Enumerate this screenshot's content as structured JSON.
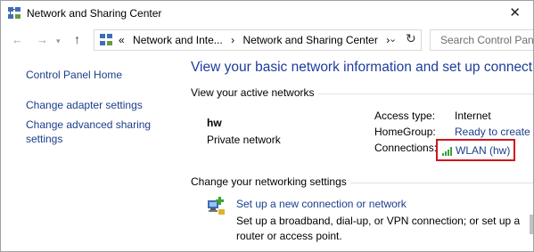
{
  "window": {
    "title": "Network and Sharing Center",
    "close_glyph": "✕"
  },
  "nav": {
    "back_glyph": "←",
    "forward_glyph": "→",
    "recent_glyph": "▾",
    "up_glyph": "↑",
    "address": {
      "overflow": "«",
      "crumb1": "Network and Inte...",
      "sep1": "›",
      "crumb2": "Network and Sharing Center",
      "sep2": "›",
      "dropdown_glyph": "⌄",
      "refresh_glyph": "↻"
    },
    "search_placeholder": "Search Control Panel"
  },
  "sidebar": {
    "home": "Control Panel Home",
    "adapter": "Change adapter settings",
    "advanced": "Change advanced sharing settings"
  },
  "main": {
    "title": "View your basic network information and set up connections",
    "active_header": "View your active networks",
    "network": {
      "name": "hw",
      "type": "Private network",
      "access_label": "Access type:",
      "access_value": "Internet",
      "homegroup_label": "HomeGroup:",
      "homegroup_value": "Ready to create",
      "connections_label": "Connections:",
      "connections_value": "WLAN (hw)"
    },
    "settings_header": "Change your networking settings",
    "setup": {
      "link": "Set up a new connection or network",
      "description": "Set up a broadband, dial-up, or VPN connection; or set up a router or access point."
    }
  },
  "colors": {
    "link": "#1a3e8c",
    "title": "#1e3d9c",
    "highlight": "#d0151d",
    "signal": "#3aa335"
  },
  "icons": {
    "title": "network-center-icon",
    "address": "network-center-icon",
    "connection": "wifi-signal-icon",
    "setup": "new-connection-icon"
  }
}
